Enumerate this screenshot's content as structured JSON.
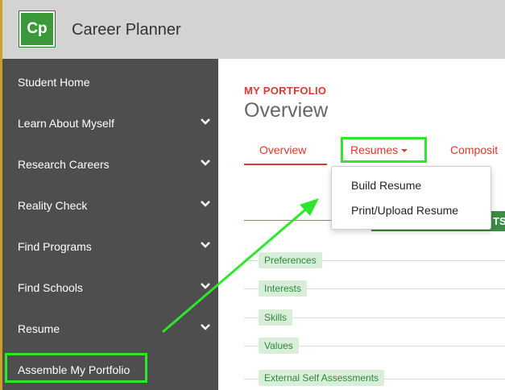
{
  "app": {
    "logo_text": "Cp",
    "title": "Career Planner"
  },
  "sidebar": {
    "items": [
      {
        "label": "Student Home",
        "has_chevron": false
      },
      {
        "label": "Learn About Myself",
        "has_chevron": true
      },
      {
        "label": "Research Careers",
        "has_chevron": true
      },
      {
        "label": "Reality Check",
        "has_chevron": true
      },
      {
        "label": "Find Programs",
        "has_chevron": true
      },
      {
        "label": "Find Schools",
        "has_chevron": true
      },
      {
        "label": "Resume",
        "has_chevron": true
      },
      {
        "label": "Assemble My Portfolio",
        "has_chevron": false
      }
    ]
  },
  "main": {
    "section_label": "MY PORTFOLIO",
    "page_title": "Overview",
    "tabs": [
      {
        "label": "Overview",
        "active": true
      },
      {
        "label": "Resumes",
        "active": false
      },
      {
        "label": "Composit",
        "active": false
      }
    ],
    "dropdown": {
      "items": [
        "Build Resume",
        "Print/Upload Resume"
      ]
    },
    "green_bar_text": "TS",
    "chips": [
      "Preferences",
      "Interests",
      "Skills",
      "Values",
      "External Self Assessments"
    ]
  },
  "colors": {
    "accent": "#d9392e",
    "sidebar_bg": "#4e4e4e",
    "highlight": "#2ee62e",
    "chip_bg": "#d9eed9",
    "chip_text": "#2a8a3a",
    "brand_green": "#3a9a3a"
  }
}
